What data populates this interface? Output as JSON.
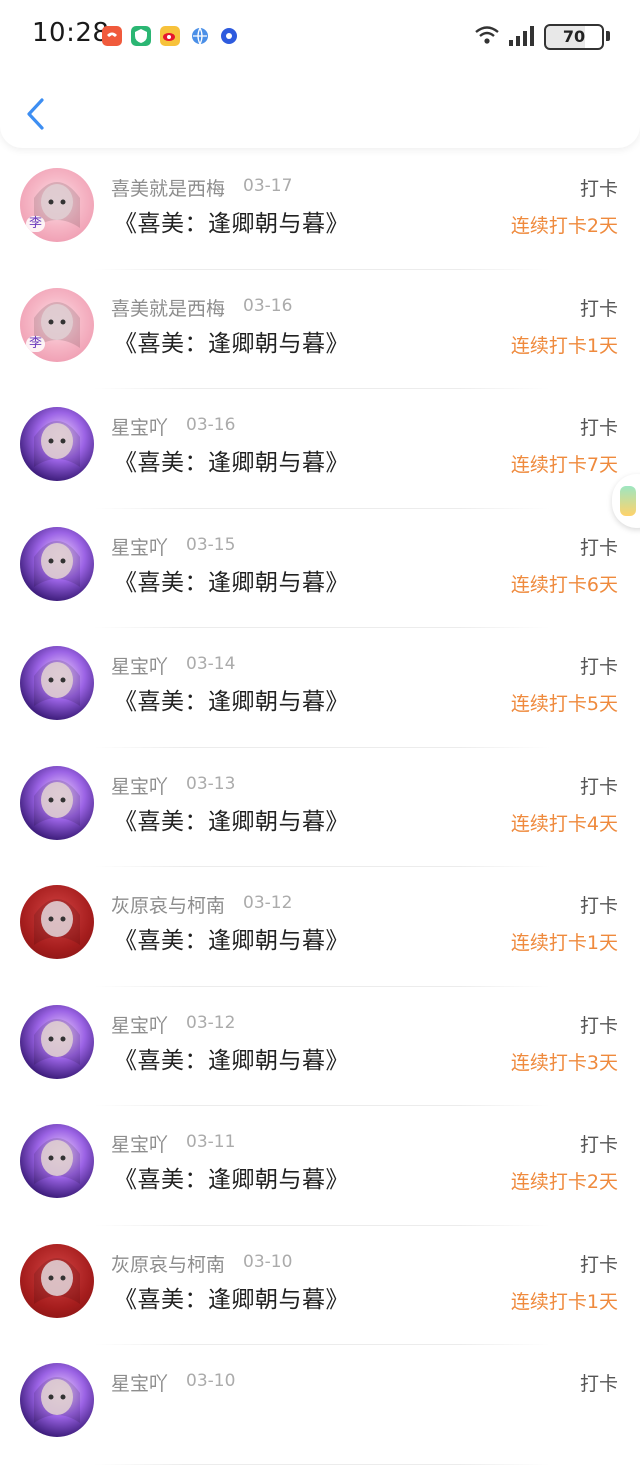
{
  "status_bar": {
    "time": "10:28",
    "battery": "70"
  },
  "entries": [
    {
      "name": "喜美就是西梅",
      "date": "03-17",
      "title": "《喜美：逢卿朝与暮》",
      "action": "打卡",
      "streak": "连续打卡2天",
      "avatar": "pink",
      "avatar_text": "李"
    },
    {
      "name": "喜美就是西梅",
      "date": "03-16",
      "title": "《喜美：逢卿朝与暮》",
      "action": "打卡",
      "streak": "连续打卡1天",
      "avatar": "pink",
      "avatar_text": "李"
    },
    {
      "name": "星宝吖",
      "date": "03-16",
      "title": "《喜美：逢卿朝与暮》",
      "action": "打卡",
      "streak": "连续打卡7天",
      "avatar": "purple"
    },
    {
      "name": "星宝吖",
      "date": "03-15",
      "title": "《喜美：逢卿朝与暮》",
      "action": "打卡",
      "streak": "连续打卡6天",
      "avatar": "purple"
    },
    {
      "name": "星宝吖",
      "date": "03-14",
      "title": "《喜美：逢卿朝与暮》",
      "action": "打卡",
      "streak": "连续打卡5天",
      "avatar": "purple"
    },
    {
      "name": "星宝吖",
      "date": "03-13",
      "title": "《喜美：逢卿朝与暮》",
      "action": "打卡",
      "streak": "连续打卡4天",
      "avatar": "purple"
    },
    {
      "name": "灰原哀与柯南",
      "date": "03-12",
      "title": "《喜美：逢卿朝与暮》",
      "action": "打卡",
      "streak": "连续打卡1天",
      "avatar": "red"
    },
    {
      "name": "星宝吖",
      "date": "03-12",
      "title": "《喜美：逢卿朝与暮》",
      "action": "打卡",
      "streak": "连续打卡3天",
      "avatar": "purple"
    },
    {
      "name": "星宝吖",
      "date": "03-11",
      "title": "《喜美：逢卿朝与暮》",
      "action": "打卡",
      "streak": "连续打卡2天",
      "avatar": "purple"
    },
    {
      "name": "灰原哀与柯南",
      "date": "03-10",
      "title": "《喜美：逢卿朝与暮》",
      "action": "打卡",
      "streak": "连续打卡1天",
      "avatar": "red"
    },
    {
      "name": "星宝吖",
      "date": "03-10",
      "title": "",
      "action": "打卡",
      "streak": "",
      "avatar": "purple"
    }
  ]
}
